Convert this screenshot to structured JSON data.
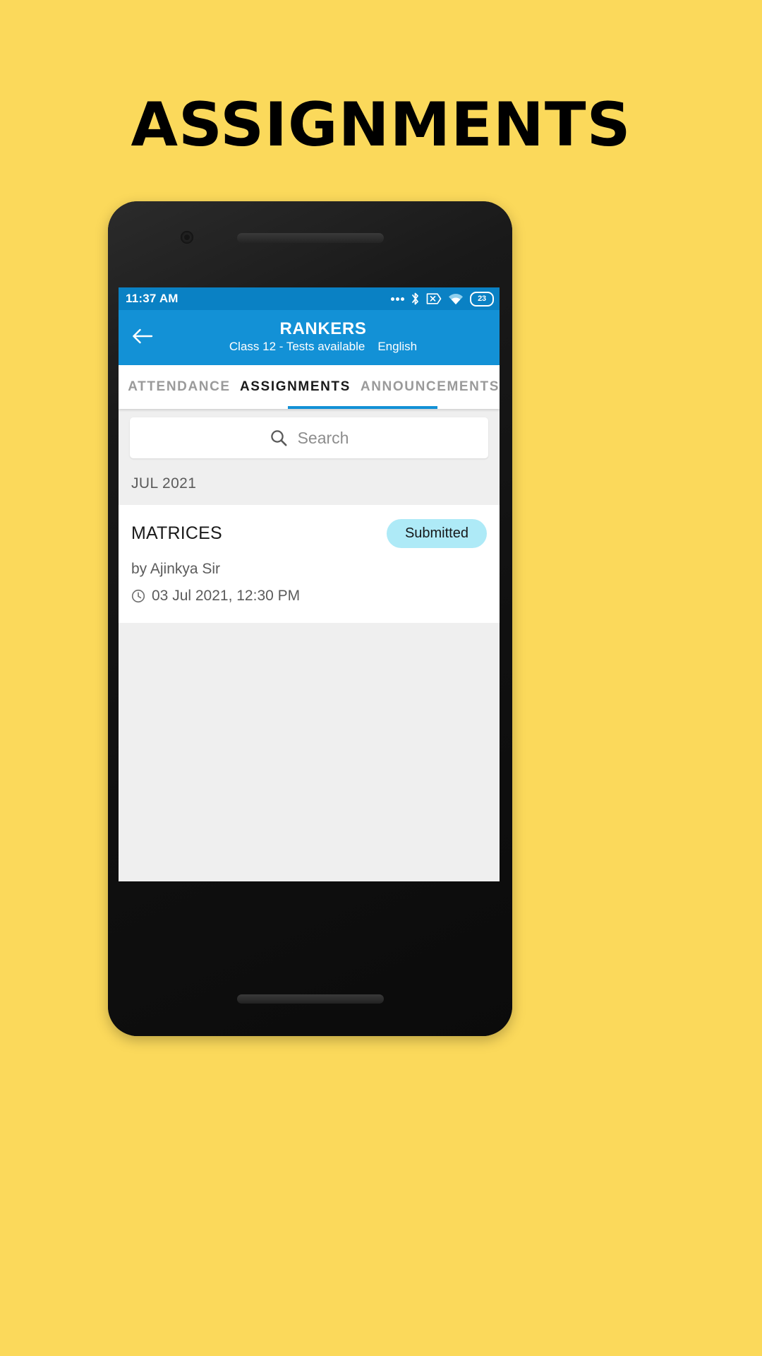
{
  "banner": {
    "title": "ASSIGNMENTS"
  },
  "status_bar": {
    "time": "11:37 AM",
    "battery_level": "23",
    "icons": [
      "more-dots-icon",
      "bluetooth-icon",
      "sim-disabled-icon",
      "wifi-icon",
      "battery-icon"
    ]
  },
  "appbar": {
    "back_icon": "arrow-left-icon",
    "title": "RANKERS",
    "subtitle_class": "Class 12 - Tests available",
    "subtitle_language": "English"
  },
  "tabs": [
    {
      "label": "ATTENDANCE",
      "active": false
    },
    {
      "label": "ASSIGNMENTS",
      "active": true
    },
    {
      "label": "ANNOUNCEMENTS",
      "active": false
    }
  ],
  "search": {
    "icon": "search-icon",
    "placeholder": "Search",
    "value": ""
  },
  "sections": [
    {
      "month_label": "JUL 2021",
      "items": [
        {
          "title": "MATRICES",
          "status": "Submitted",
          "author": "by Ajinkya Sir",
          "date_icon": "clock-icon",
          "date": "03 Jul 2021, 12:30 PM"
        }
      ]
    }
  ],
  "colors": {
    "background": "#FBD95B",
    "appbar": "#1391D6",
    "status_bar": "#0A81C4",
    "badge": "#AEEAF7",
    "tab_active": "#1A1A1A",
    "tab_inactive": "#9A9A9A",
    "content_bg": "#EFEFEF"
  }
}
